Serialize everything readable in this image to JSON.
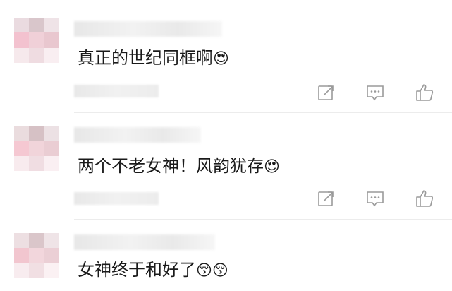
{
  "comments": [
    {
      "text": "真正的世纪同框啊",
      "emoji": "😍"
    },
    {
      "text": "两个不老女神！风韵犹存",
      "emoji": "😍"
    },
    {
      "text": "女神终于和好了",
      "emoji": "😚😚"
    }
  ],
  "icons": {
    "forward": "share-icon",
    "reply": "comment-icon",
    "like": "thumbs-up-icon"
  },
  "colors": {
    "icon": "#9a9a9a",
    "text": "#1a1a1a",
    "separator": "#ececec"
  }
}
